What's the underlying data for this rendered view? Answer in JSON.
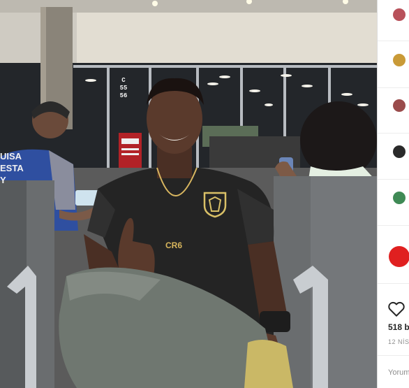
{
  "photo": {
    "alt": "Young man smiling with thumbs up in airport departure lounge",
    "sign_text": [
      "C",
      "55",
      "56"
    ],
    "background_shirt_text": [
      "UISA",
      "ESTA",
      "Y"
    ],
    "pendant_text": "CR6"
  },
  "sidebar": {
    "avatars": [
      {
        "name": "comment-avatar-1",
        "color": "#b8515a"
      },
      {
        "name": "comment-avatar-2",
        "color": "#c99a37"
      },
      {
        "name": "comment-avatar-3",
        "color": "#9a4b4b"
      },
      {
        "name": "comment-avatar-4",
        "color": "#2a2a2a"
      },
      {
        "name": "comment-avatar-5",
        "color": "#3f8a55"
      },
      {
        "name": "comment-avatar-6",
        "color": "#e02020"
      }
    ]
  },
  "actions": {
    "like_icon": "heart-icon",
    "likes_text": "518 b",
    "date_text": "12 NİS",
    "comment_placeholder": "Yorum"
  }
}
